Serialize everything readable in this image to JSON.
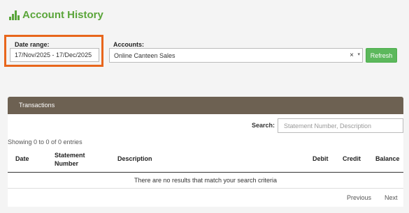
{
  "header": {
    "title": "Account History",
    "icon": "bar-chart-icon",
    "accent": "#5aa53a"
  },
  "filters": {
    "date_label": "Date range:",
    "date_value": "17/Nov/2025 - 17/Dec/2025",
    "accounts_label": "Accounts:",
    "account_value": "Online Canteen Sales",
    "clear_glyph": "×",
    "arrow_glyph": "▾",
    "refresh_label": "Refresh",
    "highlight_color": "#e8661c"
  },
  "transactions": {
    "panel_title": "Transactions",
    "search_label": "Search:",
    "search_placeholder": "Statement Number, Description",
    "info": "Showing 0 to 0 of 0 entries",
    "columns": [
      "Date",
      "Statement Number",
      "Description",
      "Debit",
      "Credit",
      "Balance"
    ],
    "empty_message": "There are no results that match your search criteria",
    "previous_label": "Previous",
    "next_label": "Next"
  }
}
